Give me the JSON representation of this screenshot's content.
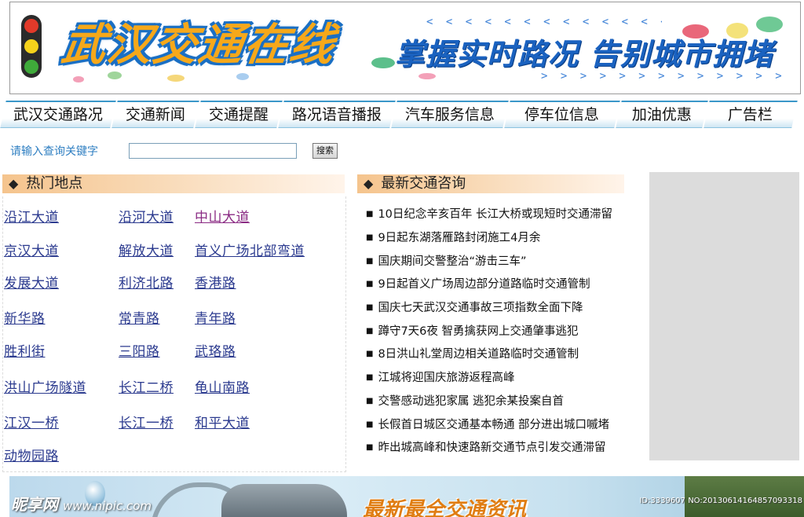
{
  "banner": {
    "logo_text": "武汉交通在线",
    "slogan": "掌握实时路况  告别城市拥堵",
    "arrows_top": "< < < < < < < < < < < < < < < < < < < < < < < < < <",
    "arrows_bottom": "> > > > > > > > > > > > > > > > > > > > > > > > > > >",
    "logo_color": "#f6a81a",
    "slogan_color": "#1a62c0"
  },
  "nav": {
    "items": [
      {
        "label": "武汉交通路况"
      },
      {
        "label": "交通新闻"
      },
      {
        "label": "交通提醒"
      },
      {
        "label": "路况语音播报"
      },
      {
        "label": "汽车服务信息"
      },
      {
        "label": "停车位信息"
      },
      {
        "label": "加油优惠"
      },
      {
        "label": "广告栏"
      }
    ]
  },
  "search": {
    "label": "请输入查询关键字",
    "value": "",
    "button_label": "搜索"
  },
  "hot_places": {
    "title": "热门地点",
    "links": [
      "沿江大道",
      "沿河大道",
      "中山大道",
      "京汉大道",
      "解放大道",
      "首义广场北部弯道",
      "发展大道",
      "利济北路",
      "香港路",
      "新华路",
      "常青路",
      "青年路",
      "胜利街",
      "三阳路",
      "武珞路",
      "洪山广场隧道",
      "长江二桥",
      "龟山南路",
      "江汉一桥",
      "长江一桥",
      "和平大道",
      "动物园路"
    ]
  },
  "news": {
    "title": "最新交通咨询",
    "items": [
      "10日纪念辛亥百年 长江大桥或现短时交通滞留",
      "9日起东湖落雁路封闭施工4月余",
      "国庆期间交警整治“游击三车”",
      "9日起首义广场周边部分道路临时交通管制",
      "国庆七天武汉交通事故三项指数全面下降",
      "蹲守7天6夜 智勇擒获网上交通肇事逃犯",
      "8日洪山礼堂周边相关道路临时交通管制",
      "江城将迎国庆旅游返程高峰",
      "交警感动逃犯家属 逃犯余某投案自首",
      "长假首日城区交通基本畅通 部分进出城口嘁堵",
      "昨出城高峰和快速路新交通节点引发交通滞留"
    ]
  },
  "bottom_banner": {
    "title": "最新最全交通资讯"
  },
  "watermark": {
    "site": "昵享网",
    "url": "www.nipic.com",
    "id_text": "ID:3339607 NO:20130614164857093318"
  }
}
